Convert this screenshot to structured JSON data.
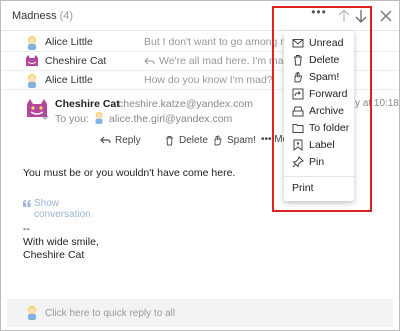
{
  "header": {
    "title": "Madness",
    "count": "(4)",
    "more_label": "•••"
  },
  "thread": [
    {
      "sender": "Alice Little",
      "snippet": "But I don't want to go among mad pe",
      "avatar": "alice-avatar"
    },
    {
      "sender": "Cheshire Cat",
      "snippet": "We're all mad here. I'm mad.",
      "avatar": "cheshire-avatar"
    },
    {
      "sender": "Alice Little",
      "snippet": "How do you know I'm mad?",
      "avatar": "alice-avatar"
    }
  ],
  "message": {
    "from": "Cheshire Cat",
    "email": "cheshire.katze@yandex.com",
    "date": "y at 10:18",
    "to_label": "To you:",
    "to_email": "alice.the.girl@yandex.com",
    "actions": {
      "reply": "Reply",
      "delete": "Delete",
      "spam": "Spam!",
      "more": "••• Mo"
    },
    "body": "You must be or you wouldn't have come here.",
    "show_conversation": "Show conversation",
    "signature": [
      "--",
      "With wide smile,",
      "Cheshire Cat"
    ]
  },
  "reply_bar": {
    "placeholder": "Click here to quick reply to all"
  },
  "menu": {
    "items": [
      {
        "label": "Unread",
        "icon": "envelope-icon"
      },
      {
        "label": "Delete",
        "icon": "trash-icon"
      },
      {
        "label": "Spam!",
        "icon": "hand-icon"
      },
      {
        "label": "Forward",
        "icon": "forward-icon"
      },
      {
        "label": "Archive",
        "icon": "archive-icon"
      },
      {
        "label": "To folder",
        "icon": "folder-icon"
      },
      {
        "label": "Label",
        "icon": "label-icon"
      },
      {
        "label": "Pin",
        "icon": "pin-icon"
      }
    ],
    "print": "Print"
  },
  "colors": {
    "highlight": "#dd2222",
    "link": "#9cb5d6",
    "muted": "#999999"
  }
}
